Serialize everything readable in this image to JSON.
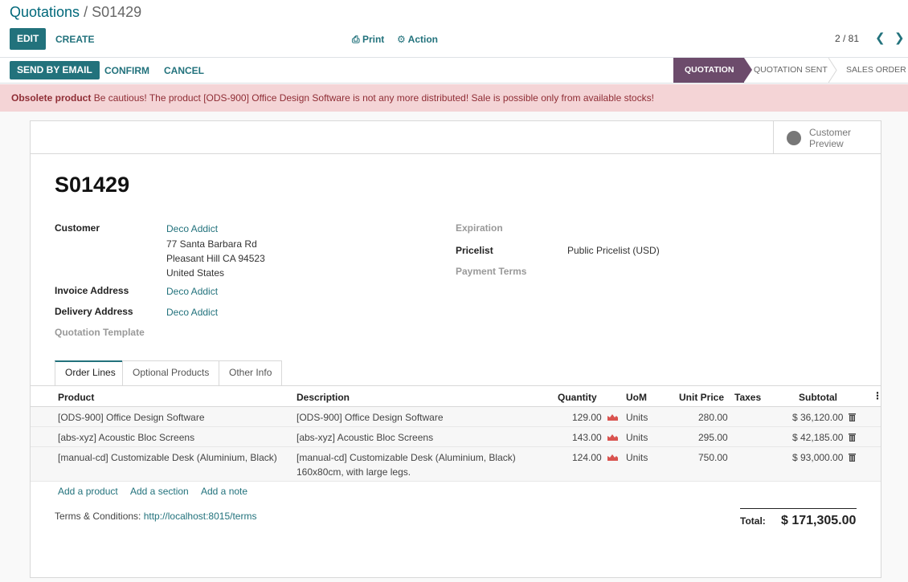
{
  "breadcrumb": {
    "parent": "Quotations",
    "separator": "/",
    "current": "S01429"
  },
  "toolbar": {
    "edit": "EDIT",
    "create": "CREATE",
    "print": "Print",
    "action": "Action"
  },
  "pager": {
    "value": "2 / 81"
  },
  "statusbar": {
    "send_email": "SEND BY EMAIL",
    "confirm": "CONFIRM",
    "cancel": "CANCEL",
    "stages": [
      "QUOTATION",
      "QUOTATION SENT",
      "SALES ORDER"
    ]
  },
  "alert": {
    "title": "Obsolete product",
    "message": "Be cautious! The product [ODS-900] Office Design Software is not any more distributed! Sale is possible only from available stocks!"
  },
  "customer_preview": {
    "line1": "Customer",
    "line2": "Preview"
  },
  "form": {
    "name": "S01429",
    "customer_label": "Customer",
    "customer_name": "Deco Addict",
    "customer_addr1": "77 Santa Barbara Rd",
    "customer_addr2": "Pleasant Hill CA 94523",
    "customer_addr3": "United States",
    "invoice_label": "Invoice Address",
    "invoice_value": "Deco Addict",
    "delivery_label": "Delivery Address",
    "delivery_value": "Deco Addict",
    "template_label": "Quotation Template",
    "expiration_label": "Expiration",
    "pricelist_label": "Pricelist",
    "pricelist_value": "Public Pricelist (USD)",
    "payment_terms_label": "Payment Terms"
  },
  "tabs": [
    "Order Lines",
    "Optional Products",
    "Other Info"
  ],
  "columns": {
    "product": "Product",
    "description": "Description",
    "quantity": "Quantity",
    "uom": "UoM",
    "unit_price": "Unit Price",
    "taxes": "Taxes",
    "subtotal": "Subtotal"
  },
  "lines": [
    {
      "product": "[ODS-900] Office Design Software",
      "description": "[ODS-900] Office Design Software",
      "description2": "",
      "quantity": "129.00",
      "uom": "Units",
      "unit_price": "280.00",
      "subtotal": "$ 36,120.00"
    },
    {
      "product": "[abs-xyz] Acoustic Bloc Screens",
      "description": "[abs-xyz] Acoustic Bloc Screens",
      "description2": "",
      "quantity": "143.00",
      "uom": "Units",
      "unit_price": "295.00",
      "subtotal": "$ 42,185.00"
    },
    {
      "product": "[manual-cd] Customizable Desk (Aluminium, Black)",
      "description": "[manual-cd] Customizable Desk (Aluminium, Black)",
      "description2": "160x80cm, with large legs.",
      "quantity": "124.00",
      "uom": "Units",
      "unit_price": "750.00",
      "subtotal": "$ 93,000.00"
    }
  ],
  "add_links": {
    "product": "Add a product",
    "section": "Add a section",
    "note": "Add a note"
  },
  "terms": {
    "label": "Terms & Conditions:",
    "url": "http://localhost:8015/terms"
  },
  "total": {
    "label": "Total:",
    "value": "$ 171,305.00"
  },
  "colors": {
    "primary": "#22727c",
    "stage_active": "#6c4b6b",
    "alert_bg": "#f4d4d6",
    "alert_text": "#8f2d35",
    "chart_icon": "#d9534f"
  }
}
